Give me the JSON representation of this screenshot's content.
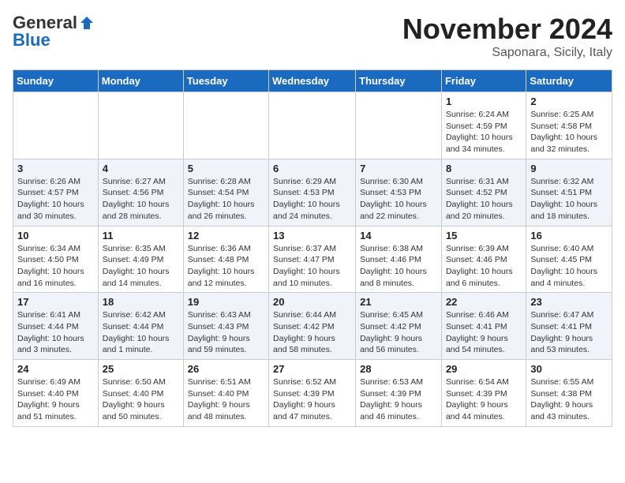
{
  "logo": {
    "general": "General",
    "blue": "Blue"
  },
  "title": "November 2024",
  "subtitle": "Saponara, Sicily, Italy",
  "headers": [
    "Sunday",
    "Monday",
    "Tuesday",
    "Wednesday",
    "Thursday",
    "Friday",
    "Saturday"
  ],
  "weeks": [
    [
      {
        "day": "",
        "info": ""
      },
      {
        "day": "",
        "info": ""
      },
      {
        "day": "",
        "info": ""
      },
      {
        "day": "",
        "info": ""
      },
      {
        "day": "",
        "info": ""
      },
      {
        "day": "1",
        "info": "Sunrise: 6:24 AM\nSunset: 4:59 PM\nDaylight: 10 hours and 34 minutes."
      },
      {
        "day": "2",
        "info": "Sunrise: 6:25 AM\nSunset: 4:58 PM\nDaylight: 10 hours and 32 minutes."
      }
    ],
    [
      {
        "day": "3",
        "info": "Sunrise: 6:26 AM\nSunset: 4:57 PM\nDaylight: 10 hours and 30 minutes."
      },
      {
        "day": "4",
        "info": "Sunrise: 6:27 AM\nSunset: 4:56 PM\nDaylight: 10 hours and 28 minutes."
      },
      {
        "day": "5",
        "info": "Sunrise: 6:28 AM\nSunset: 4:54 PM\nDaylight: 10 hours and 26 minutes."
      },
      {
        "day": "6",
        "info": "Sunrise: 6:29 AM\nSunset: 4:53 PM\nDaylight: 10 hours and 24 minutes."
      },
      {
        "day": "7",
        "info": "Sunrise: 6:30 AM\nSunset: 4:53 PM\nDaylight: 10 hours and 22 minutes."
      },
      {
        "day": "8",
        "info": "Sunrise: 6:31 AM\nSunset: 4:52 PM\nDaylight: 10 hours and 20 minutes."
      },
      {
        "day": "9",
        "info": "Sunrise: 6:32 AM\nSunset: 4:51 PM\nDaylight: 10 hours and 18 minutes."
      }
    ],
    [
      {
        "day": "10",
        "info": "Sunrise: 6:34 AM\nSunset: 4:50 PM\nDaylight: 10 hours and 16 minutes."
      },
      {
        "day": "11",
        "info": "Sunrise: 6:35 AM\nSunset: 4:49 PM\nDaylight: 10 hours and 14 minutes."
      },
      {
        "day": "12",
        "info": "Sunrise: 6:36 AM\nSunset: 4:48 PM\nDaylight: 10 hours and 12 minutes."
      },
      {
        "day": "13",
        "info": "Sunrise: 6:37 AM\nSunset: 4:47 PM\nDaylight: 10 hours and 10 minutes."
      },
      {
        "day": "14",
        "info": "Sunrise: 6:38 AM\nSunset: 4:46 PM\nDaylight: 10 hours and 8 minutes."
      },
      {
        "day": "15",
        "info": "Sunrise: 6:39 AM\nSunset: 4:46 PM\nDaylight: 10 hours and 6 minutes."
      },
      {
        "day": "16",
        "info": "Sunrise: 6:40 AM\nSunset: 4:45 PM\nDaylight: 10 hours and 4 minutes."
      }
    ],
    [
      {
        "day": "17",
        "info": "Sunrise: 6:41 AM\nSunset: 4:44 PM\nDaylight: 10 hours and 3 minutes."
      },
      {
        "day": "18",
        "info": "Sunrise: 6:42 AM\nSunset: 4:44 PM\nDaylight: 10 hours and 1 minute."
      },
      {
        "day": "19",
        "info": "Sunrise: 6:43 AM\nSunset: 4:43 PM\nDaylight: 9 hours and 59 minutes."
      },
      {
        "day": "20",
        "info": "Sunrise: 6:44 AM\nSunset: 4:42 PM\nDaylight: 9 hours and 58 minutes."
      },
      {
        "day": "21",
        "info": "Sunrise: 6:45 AM\nSunset: 4:42 PM\nDaylight: 9 hours and 56 minutes."
      },
      {
        "day": "22",
        "info": "Sunrise: 6:46 AM\nSunset: 4:41 PM\nDaylight: 9 hours and 54 minutes."
      },
      {
        "day": "23",
        "info": "Sunrise: 6:47 AM\nSunset: 4:41 PM\nDaylight: 9 hours and 53 minutes."
      }
    ],
    [
      {
        "day": "24",
        "info": "Sunrise: 6:49 AM\nSunset: 4:40 PM\nDaylight: 9 hours and 51 minutes."
      },
      {
        "day": "25",
        "info": "Sunrise: 6:50 AM\nSunset: 4:40 PM\nDaylight: 9 hours and 50 minutes."
      },
      {
        "day": "26",
        "info": "Sunrise: 6:51 AM\nSunset: 4:40 PM\nDaylight: 9 hours and 48 minutes."
      },
      {
        "day": "27",
        "info": "Sunrise: 6:52 AM\nSunset: 4:39 PM\nDaylight: 9 hours and 47 minutes."
      },
      {
        "day": "28",
        "info": "Sunrise: 6:53 AM\nSunset: 4:39 PM\nDaylight: 9 hours and 46 minutes."
      },
      {
        "day": "29",
        "info": "Sunrise: 6:54 AM\nSunset: 4:39 PM\nDaylight: 9 hours and 44 minutes."
      },
      {
        "day": "30",
        "info": "Sunrise: 6:55 AM\nSunset: 4:38 PM\nDaylight: 9 hours and 43 minutes."
      }
    ]
  ]
}
